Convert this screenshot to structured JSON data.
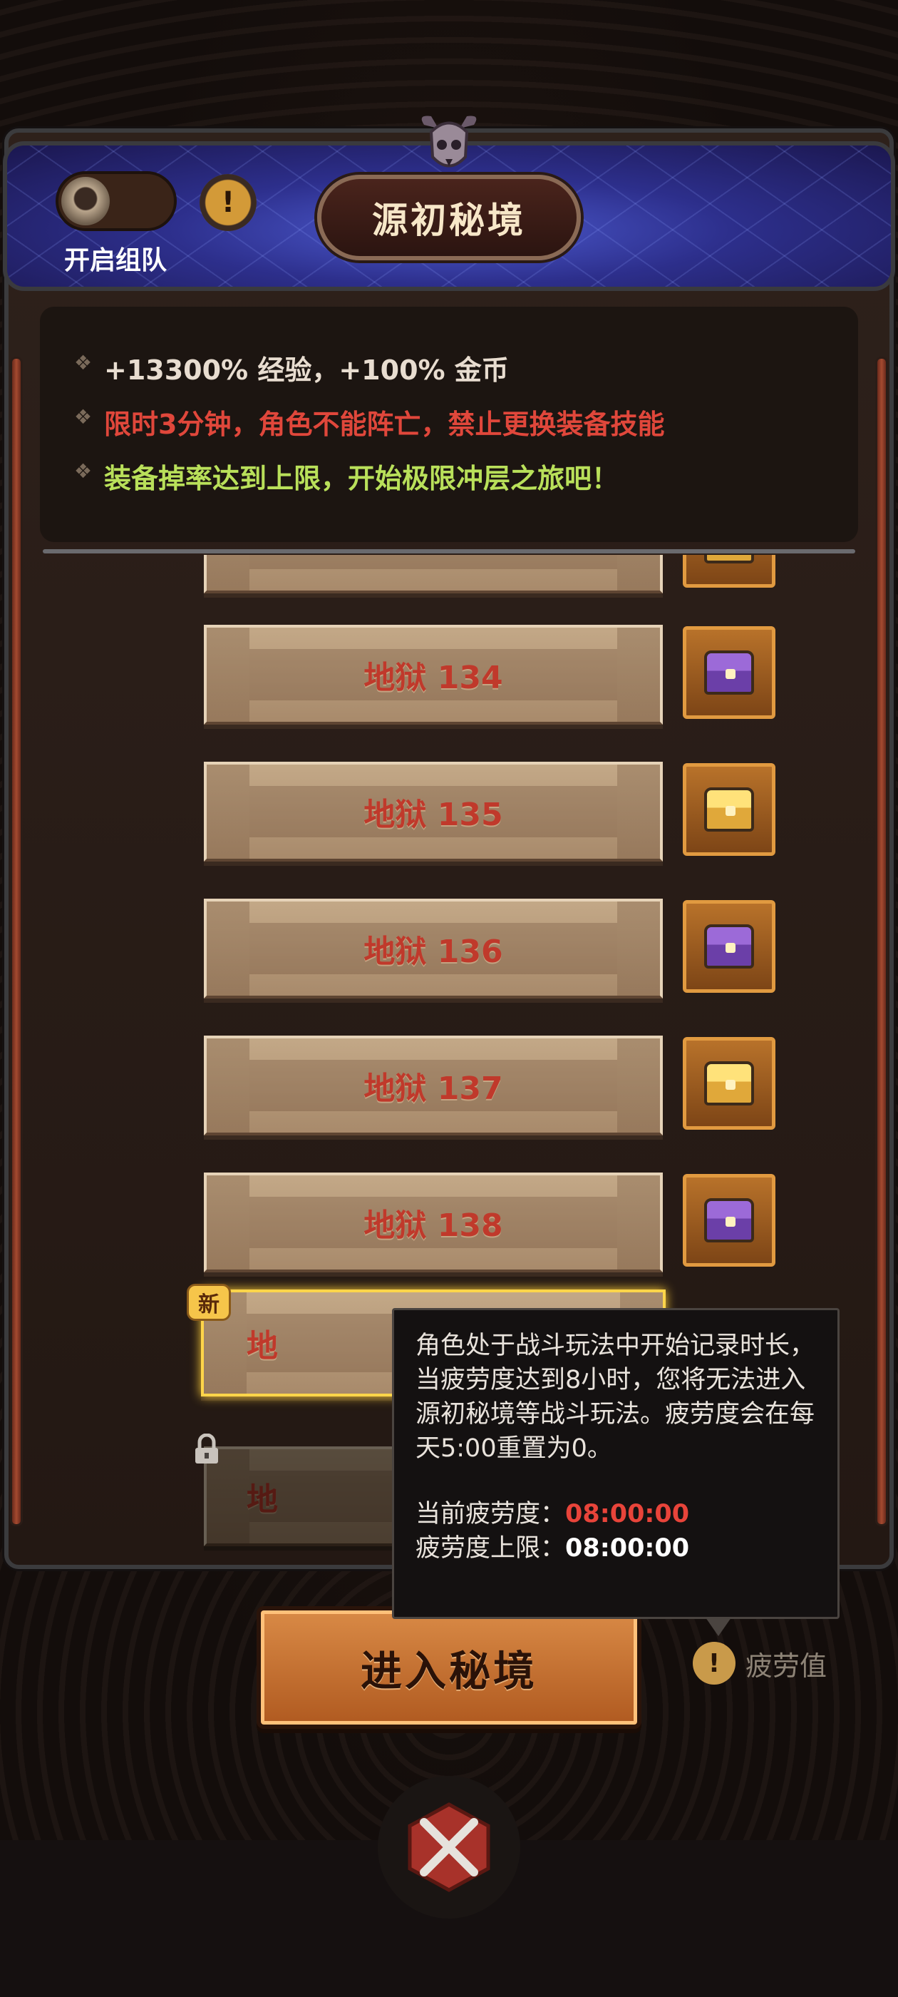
{
  "header": {
    "title": "源初秘境",
    "team_toggle_label": "开启组队",
    "team_toggle_on": false
  },
  "info": {
    "lines": [
      {
        "text": "+13300% 经验，+100% 金币",
        "color": "#e8ddd0"
      },
      {
        "text": "限时3分钟，角色不能阵亡，禁止更换装备技能",
        "color": "#e0473b"
      },
      {
        "text": "装备掉率达到上限，开始极限冲层之旅吧！",
        "color": "#b9e05a"
      }
    ]
  },
  "levels": [
    {
      "label": "",
      "chest": "gold",
      "state": "normal"
    },
    {
      "label": "地狱 134",
      "chest": "purple",
      "state": "normal"
    },
    {
      "label": "地狱 135",
      "chest": "gold",
      "state": "normal"
    },
    {
      "label": "地狱 136",
      "chest": "purple",
      "state": "normal"
    },
    {
      "label": "地狱 137",
      "chest": "gold",
      "state": "normal"
    },
    {
      "label": "地狱 138",
      "chest": "purple",
      "state": "normal"
    },
    {
      "label": "地",
      "chest": "",
      "state": "current"
    },
    {
      "label": "地",
      "chest": "",
      "state": "locked"
    }
  ],
  "new_badge": "新",
  "tooltip": {
    "text": "角色处于战斗玩法中开始记录时长，当疲劳度达到8小时，您将无法进入源初秘境等战斗玩法。疲劳度会在每天5:00重置为0。",
    "current_label": "当前疲劳度：",
    "current_value": "08:00:00",
    "limit_label": "疲劳度上限：",
    "limit_value": "08:00:00"
  },
  "enter_button": "进入秘境",
  "fatigue_label": "疲劳值",
  "colors": {
    "accent_red": "#e8443a",
    "level_text": "#c0392b",
    "button_orange": "#d98a46"
  }
}
